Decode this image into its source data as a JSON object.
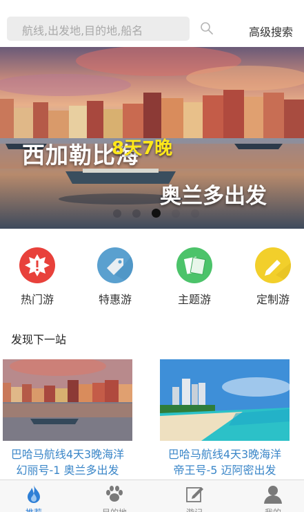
{
  "search": {
    "placeholder": "航线,出发地,目的地,船名",
    "advanced_label": "高级搜索"
  },
  "banner": {
    "title": "西加勒比海",
    "duration": "8天7晚",
    "departure": "奥兰多出发",
    "slide_count": 5,
    "active_slide": 3
  },
  "categories": [
    {
      "label": "热门游",
      "icon": "hot-burst-icon",
      "color": "#e8413b"
    },
    {
      "label": "特惠游",
      "icon": "tag-icon",
      "color": "#5aa0cf"
    },
    {
      "label": "主题游",
      "icon": "cards-icon",
      "color": "#4cc36a"
    },
    {
      "label": "定制游",
      "icon": "pencil-icon",
      "color": "#f2cf2b"
    }
  ],
  "section": {
    "title": "发现下一站"
  },
  "cards": [
    {
      "line1": "巴哈马航线4天3晚海洋",
      "line2": "幻丽号-1 奥兰多出发"
    },
    {
      "line1": "巴哈马航线4天3晚海洋",
      "line2": "帝王号-5 迈阿密出发"
    }
  ],
  "tabbar": {
    "items": [
      {
        "label": "推荐",
        "icon": "flame-icon",
        "active": true
      },
      {
        "label": "目的地",
        "icon": "paw-icon",
        "active": false
      },
      {
        "label": "游记",
        "icon": "edit-note-icon",
        "active": false
      },
      {
        "label": "我的",
        "icon": "user-icon",
        "active": false
      }
    ]
  },
  "colors": {
    "accent": "#2e7fd6",
    "card_title": "#3a86c8",
    "banner_highlight": "#ffe81a"
  }
}
